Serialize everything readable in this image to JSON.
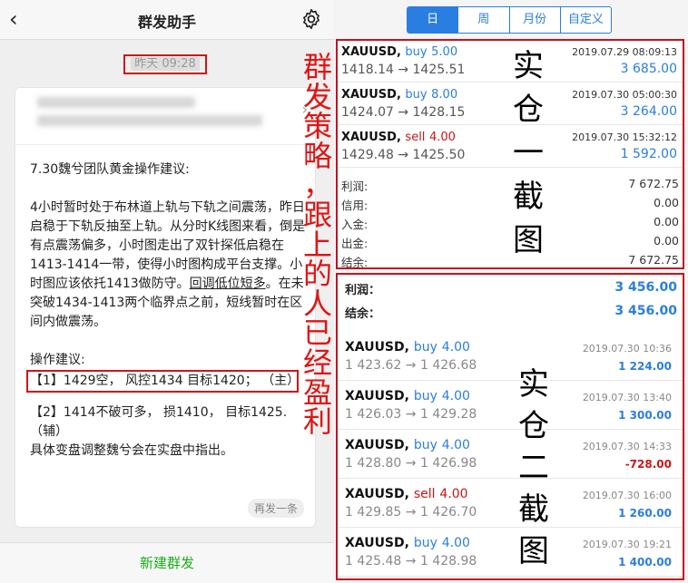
{
  "left": {
    "back_icon": "chevron-left-icon",
    "title": "群发助手",
    "settings_icon": "gear-icon",
    "timestamp": "昨天 09:28",
    "message": {
      "title": "7.30魏兮团队黄金操作建议:",
      "para1_a": "4小时暂时处于布林道上轨与下轨之间震荡，昨日启稳于下轨反抽至上轨。从分时K线图来看，倒是有点震荡偏多，小时图走出了双针探低启稳在1413-1414一带，使得小时图构成平台支撑。小时图应该依托1413做防守。",
      "para1_ul": "回调低位短多",
      "para1_b": "。在未突破1434-1413两个临界点之前，短线暂时在区间内做震荡。",
      "advice_label": "操作建议:",
      "advice1": "【1】1429空， 风控1434 目标1420； （主）",
      "advice2": "【2】1414不破可多， 损1410， 目标1425.（辅）",
      "closing": "具体变盘调整魏兮会在实盘中指出。"
    },
    "resend": "再发一条",
    "footer": "新建群发",
    "overlay_text": [
      "群",
      "发",
      "策",
      "略",
      "，",
      "跟",
      "上",
      "的",
      "人",
      "已",
      "经",
      "盈",
      "利"
    ]
  },
  "right": {
    "tabs": [
      "日",
      "周",
      "月份",
      "自定义"
    ],
    "box1": {
      "trades": [
        {
          "symbol": "XAUUSD,",
          "side": "buy",
          "lots": "5.00",
          "price": "1418.14 → 1425.51",
          "time": "2019.07.29 08:09:13",
          "profit": "3 685.00"
        },
        {
          "symbol": "XAUUSD,",
          "side": "buy",
          "lots": "8.00",
          "price": "1424.07 → 1428.15",
          "time": "2019.07.30 05:00:30",
          "profit": "3 264.00"
        },
        {
          "symbol": "XAUUSD,",
          "side": "sell",
          "lots": "4.00",
          "price": "1429.48 → 1425.50",
          "time": "2019.07.30 15:32:12",
          "profit": "1 592.00"
        }
      ],
      "summary": [
        {
          "k": "利润:",
          "v": "7 672.75"
        },
        {
          "k": "信用:",
          "v": "0.00"
        },
        {
          "k": "入金:",
          "v": "0.00"
        },
        {
          "k": "出金:",
          "v": "0.00"
        },
        {
          "k": "结余:",
          "v": "7 672.75"
        }
      ],
      "caption": [
        "实",
        "仓",
        "一",
        "截",
        "图"
      ]
    },
    "box2": {
      "profit_label": "利润：",
      "profit_value": "3 456.00",
      "balance_label": "结余：",
      "balance_value": "3 456.00",
      "trades": [
        {
          "symbol": "XAUUSD,",
          "side": "buy",
          "lots": "4.00",
          "price": "1 423.62 → 1 426.68",
          "time": "2019.07.30 10:36",
          "profit": "1 224.00",
          "neg": false
        },
        {
          "symbol": "XAUUSD,",
          "side": "buy",
          "lots": "4.00",
          "price": "1 426.03 → 1 429.28",
          "time": "2019.07.30 13:40",
          "profit": "1 300.00",
          "neg": false
        },
        {
          "symbol": "XAUUSD,",
          "side": "buy",
          "lots": "4.00",
          "price": "1 428.80 → 1 426.98",
          "time": "2019.07.30 14:33",
          "profit": "-728.00",
          "neg": true
        },
        {
          "symbol": "XAUUSD,",
          "side": "sell",
          "lots": "4.00",
          "price": "1 429.85 → 1 426.70",
          "time": "2019.07.30 16:00",
          "profit": "1 260.00",
          "neg": false
        },
        {
          "symbol": "XAUUSD,",
          "side": "buy",
          "lots": "4.00",
          "price": "1 425.48 → 1 428.98",
          "time": "2019.07.30 19:21",
          "profit": "1 400.00",
          "neg": false
        }
      ],
      "caption": [
        "实",
        "仓",
        "二",
        "截",
        "图"
      ]
    },
    "colors": {
      "accent": "#2a7de1",
      "negative": "#d01414",
      "frame": "#c0141f"
    }
  }
}
